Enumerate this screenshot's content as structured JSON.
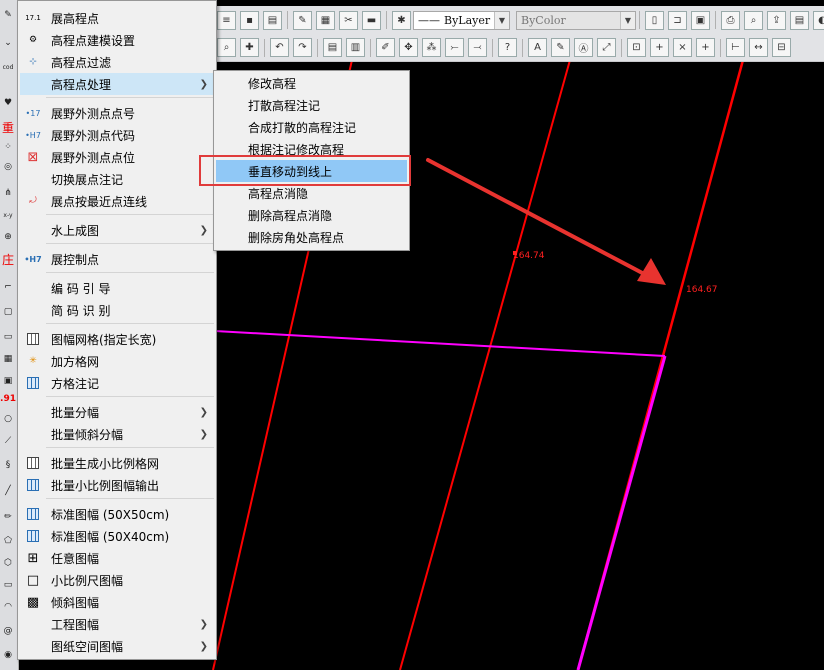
{
  "toolbar": {
    "linetype_value": "ByLayer",
    "color_value": "ByColor"
  },
  "left_strip": {
    "labels": [
      "17.1",
      "重",
      "庄",
      ".91"
    ]
  },
  "main_menu": {
    "items": [
      {
        "label": "展高程点",
        "icon": "elevation-point-icon",
        "glyph": "17.1",
        "submenu": false
      },
      {
        "label": "高程点建模设置",
        "icon": "elevation-model-icon",
        "glyph": "⚙",
        "submenu": false
      },
      {
        "label": "高程点过滤",
        "icon": "filter-icon",
        "glyph": "⊹",
        "submenu": false
      },
      {
        "label": "高程点处理",
        "icon": "",
        "glyph": "",
        "submenu": true,
        "active": true
      },
      {
        "label": "展野外测点点号",
        "icon": "point-number-icon",
        "glyph": "•17",
        "submenu": false
      },
      {
        "label": "展野外测点代码",
        "icon": "point-code-icon",
        "glyph": "•H7",
        "submenu": false
      },
      {
        "label": "展野外测点点位",
        "icon": "point-position-icon",
        "glyph": "⊠",
        "submenu": false
      },
      {
        "label": "切换展点注记",
        "icon": "",
        "glyph": "",
        "submenu": false
      },
      {
        "label": "展点按最近点连线",
        "icon": "nearest-connect-icon",
        "glyph": "⤾",
        "submenu": false
      },
      {
        "label": "水上成图",
        "icon": "",
        "glyph": "",
        "submenu": true
      },
      {
        "label": "展控制点",
        "icon": "control-point-icon",
        "glyph": "•H7",
        "submenu": false
      },
      {
        "label": "编 码 引 导",
        "icon": "",
        "glyph": "",
        "submenu": false
      },
      {
        "label": "简 码 识 别",
        "icon": "",
        "glyph": "",
        "submenu": false
      },
      {
        "label": "图幅网格(指定长宽)",
        "icon": "map-grid-icon",
        "glyph": "▦",
        "submenu": false
      },
      {
        "label": "加方格网",
        "icon": "add-grid-icon",
        "glyph": "✳",
        "submenu": false
      },
      {
        "label": "方格注记",
        "icon": "grid-annotation-icon",
        "glyph": "▤",
        "submenu": false
      },
      {
        "label": "批量分幅",
        "icon": "",
        "glyph": "",
        "submenu": true
      },
      {
        "label": "批量倾斜分幅",
        "icon": "",
        "glyph": "",
        "submenu": true
      },
      {
        "label": "批量生成小比例格网",
        "icon": "small-scale-grid-icon",
        "glyph": "▦",
        "submenu": false
      },
      {
        "label": "批量小比例图幅输出",
        "icon": "small-scale-output-icon",
        "glyph": "▦",
        "submenu": false
      },
      {
        "label": "标准图幅 (50X50cm)",
        "icon": "standard-map-icon",
        "glyph": "▦",
        "submenu": false
      },
      {
        "label": "标准图幅 (50X40cm)",
        "icon": "standard-map-icon",
        "glyph": "▦",
        "submenu": false
      },
      {
        "label": "任意图幅",
        "icon": "any-map-icon",
        "glyph": "⊞",
        "submenu": false
      },
      {
        "label": "小比例尺图幅",
        "icon": "small-scale-map-icon",
        "glyph": "□",
        "submenu": false
      },
      {
        "label": "倾斜图幅",
        "icon": "oblique-map-icon",
        "glyph": "▩",
        "submenu": false
      },
      {
        "label": "工程图幅",
        "icon": "",
        "glyph": "",
        "submenu": true
      },
      {
        "label": "图纸空间图幅",
        "icon": "",
        "glyph": "",
        "submenu": true
      }
    ]
  },
  "sub_menu": {
    "items": [
      {
        "label": "修改高程"
      },
      {
        "label": "打散高程注记"
      },
      {
        "label": "合成打散的高程注记"
      },
      {
        "label": "根据注记修改高程"
      },
      {
        "label": "垂直移动到线上",
        "highlighted": true
      },
      {
        "label": "高程点消隐"
      },
      {
        "label": "删除高程点消隐"
      },
      {
        "label": "删除房角处高程点"
      }
    ]
  },
  "drawing": {
    "annotation_1": "164.74",
    "annotation_2": "164.67",
    "line_color": "#ff0000",
    "boundary_color": "#ff00ff",
    "arrow_color": "#e8332f"
  }
}
